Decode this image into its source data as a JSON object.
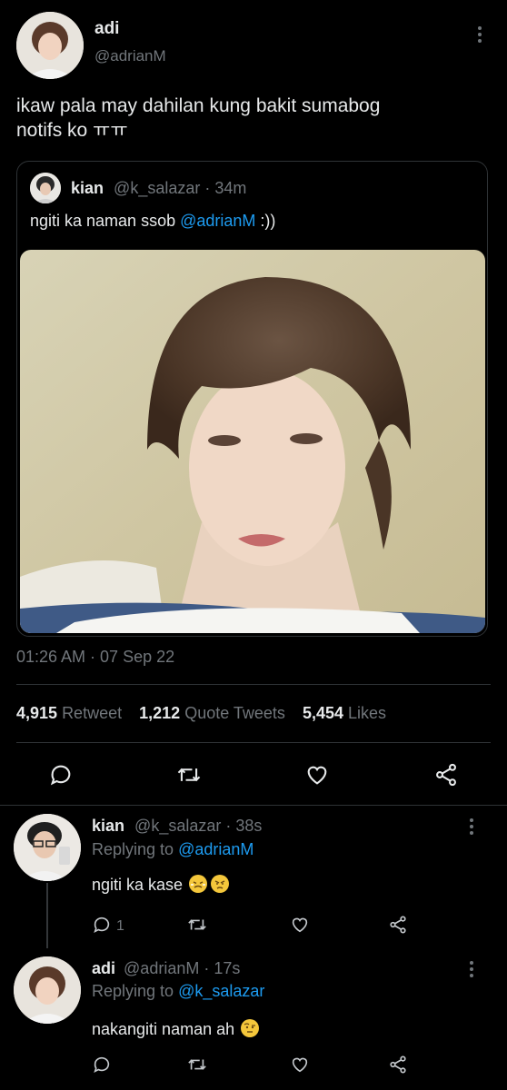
{
  "main_tweet": {
    "display_name": "adi",
    "handle": "@adrianM",
    "text_line1": "ikaw pala may dahilan kung bakit sumabog",
    "text_line2": "notifs ko ㅠㅠ",
    "timestamp": "01:26 AM · 07 Sep 22"
  },
  "quoted_tweet": {
    "display_name": "kian",
    "handle": "@k_salazar",
    "time": "· 34m",
    "text": "ngiti ka naman ssob ",
    "mention": "@adrianM",
    "text_end": " :))"
  },
  "stats": {
    "retweets_count": "4,915",
    "retweets_label": "Retweet",
    "quotes_count": "1,212",
    "quotes_label": "Quote Tweets",
    "likes_count": "5,454",
    "likes_label": "Likes"
  },
  "replies": [
    {
      "display_name": "kian",
      "handle": "@k_salazar",
      "time": "· 38s",
      "replying_label": "Replying to ",
      "replying_to": "@adrianM",
      "text": "ngiti ka kase ",
      "reply_count": "1",
      "emojis": [
        "persevering-face-emoji",
        "angry-face-emoji"
      ]
    },
    {
      "display_name": "adi",
      "handle": "@adrianM",
      "time": "· 17s",
      "replying_label": "Replying to ",
      "replying_to": "@k_salazar",
      "text": "nakangiti naman ah ",
      "emojis": [
        "raised-eyebrow-face-emoji"
      ]
    }
  ],
  "icons": [
    "reply-icon",
    "retweet-icon",
    "like-icon",
    "share-icon",
    "more-icon"
  ],
  "colors": {
    "background": "#000000",
    "text": "#e7e9ea",
    "secondary": "#71767b",
    "link": "#1d9bf0",
    "border": "#2f3336"
  }
}
